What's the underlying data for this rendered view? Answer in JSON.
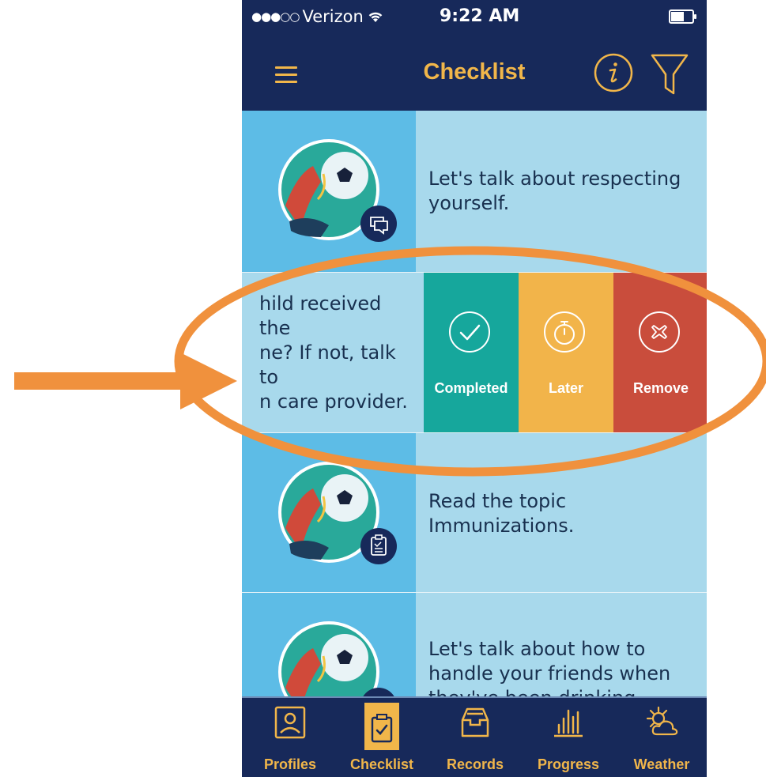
{
  "status_bar": {
    "carrier": "Verizon",
    "time": "9:22 AM",
    "signal_icon": "signal-dots-icon",
    "wifi_icon": "wifi-icon",
    "battery_icon": "battery-icon"
  },
  "nav": {
    "title": "Checklist",
    "menu_icon": "hamburger-menu-icon",
    "info_icon": "info-icon",
    "filter_icon": "filter-icon"
  },
  "items": [
    {
      "text": "Let's talk about respecting yourself.",
      "badge_icon": "chat-icon",
      "image": "soccer-icon"
    },
    {
      "text": "hild received the\nne? If not, talk to\nn care provider.",
      "image": "soccer-icon"
    },
    {
      "text": "Read the topic Immunizations.",
      "badge_icon": "clipboard-icon",
      "image": "soccer-icon"
    },
    {
      "text": "Let's talk about how to handle your friends when they've been drinking",
      "badge_icon": "chat-icon",
      "image": "soccer-icon"
    }
  ],
  "swipe_actions": [
    {
      "label": "Completed",
      "icon": "check-circle-icon",
      "color": "#16a79c"
    },
    {
      "label": "Later",
      "icon": "stopwatch-icon",
      "color": "#f2b44a"
    },
    {
      "label": "Remove",
      "icon": "x-circle-icon",
      "color": "#c94d3c"
    }
  ],
  "tabs": [
    {
      "label": "Profiles",
      "icon": "profile-icon"
    },
    {
      "label": "Checklist",
      "icon": "checklist-icon",
      "active": true
    },
    {
      "label": "Records",
      "icon": "records-tray-icon"
    },
    {
      "label": "Progress",
      "icon": "bar-chart-icon"
    },
    {
      "label": "Weather",
      "icon": "weather-sun-cloud-icon"
    }
  ],
  "colors": {
    "nav_bg": "#17295a",
    "accent": "#f1b64a",
    "row_bg": "#a8d9ec",
    "thumb_bg": "#5dbce6",
    "annotation": "#f0913d"
  }
}
